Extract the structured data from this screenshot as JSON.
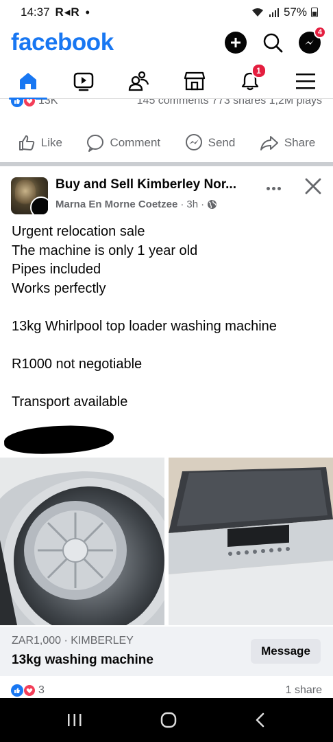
{
  "status_bar": {
    "time": "14:37",
    "apps": "R◂R",
    "dot": "•",
    "battery": "57%"
  },
  "header": {
    "logo": "facebook",
    "messenger_badge": "4"
  },
  "nav": {
    "notifications_badge": "1"
  },
  "previous_post": {
    "reactions": "13K",
    "stats": "145 comments  773 shares  1,2M plays",
    "actions": {
      "like": "Like",
      "comment": "Comment",
      "send": "Send",
      "share": "Share"
    }
  },
  "post": {
    "group_name": "Buy and Sell Kimberley Nor...",
    "author": "Marna En Morne Coetzee",
    "time": "3h",
    "separator": "·",
    "text_lines": [
      "Urgent relocation sale",
      "The machine is only 1 year old",
      "Pipes included",
      "Works perfectly",
      "",
      "13kg Whirlpool top loader washing machine",
      "",
      "R1000 not negotiable",
      "",
      "Transport available"
    ],
    "listing": {
      "price_location": "ZAR1,000 · KIMBERLEY",
      "title": "13kg washing machine",
      "message_button": "Message"
    },
    "reactions_count": "3",
    "shares": "1 share"
  },
  "colors": {
    "brand": "#1877f2",
    "badge": "#e41e3f",
    "secondary_text": "#65676b"
  }
}
